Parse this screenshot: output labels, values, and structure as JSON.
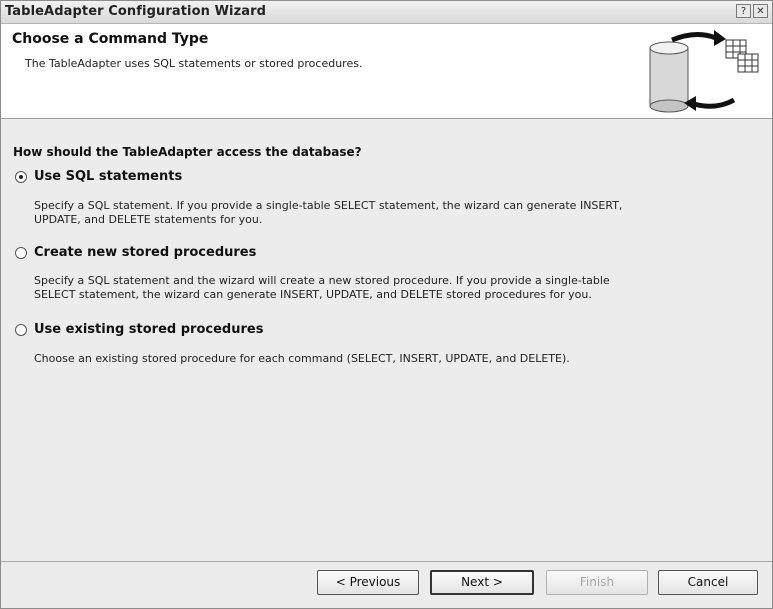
{
  "window": {
    "title": "TableAdapter Configuration Wizard",
    "help_glyph": "?",
    "close_glyph": "✕"
  },
  "header": {
    "title": "Choose a Command Type",
    "subtitle": "The TableAdapter uses SQL statements or stored procedures.",
    "icon": "database-tables-icon"
  },
  "main": {
    "question": "How should the TableAdapter access the database?",
    "options": [
      {
        "label": "Use SQL statements",
        "selected": true,
        "description_lines": [
          "Specify a SQL statement. If you provide a single-table SELECT statement, the wizard can generate INSERT,",
          "UPDATE, and DELETE statements for you."
        ]
      },
      {
        "label": "Create new stored procedures",
        "selected": false,
        "description_lines": [
          "Specify a SQL statement and the wizard will create a new stored procedure. If you provide a single-table",
          "SELECT statement, the wizard can generate INSERT, UPDATE, and DELETE stored procedures for you."
        ]
      },
      {
        "label": "Use existing stored procedures",
        "selected": false,
        "description_lines": [
          "Choose an existing stored procedure for each command (SELECT, INSERT, UPDATE, and DELETE)."
        ]
      }
    ]
  },
  "footer": {
    "previous_label": "< Previous",
    "next_label": "Next >",
    "finish_label": "Finish",
    "cancel_label": "Cancel"
  }
}
